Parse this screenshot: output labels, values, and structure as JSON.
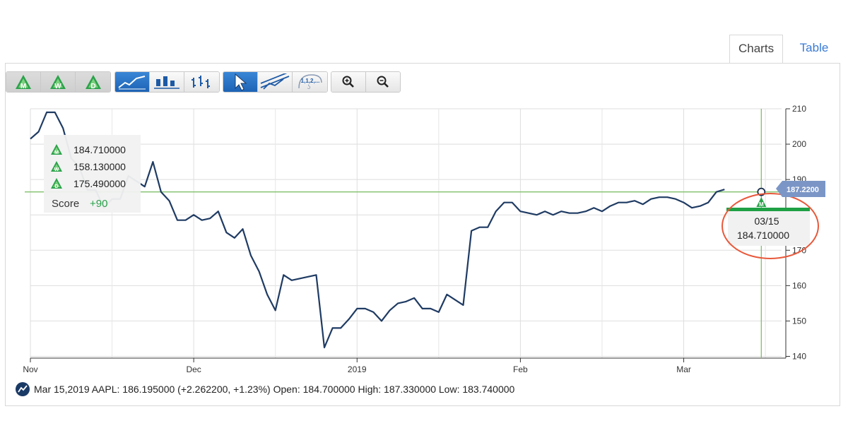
{
  "tabs": [
    {
      "label": "Charts",
      "active": true
    },
    {
      "label": "Table",
      "active": false
    }
  ],
  "toolbar": {
    "groups": [
      [
        {
          "name": "mag-m-icon",
          "letter": "M",
          "state": "on"
        },
        {
          "name": "mag-w-icon",
          "letter": "W",
          "state": "on"
        },
        {
          "name": "mag-d-icon",
          "letter": "D",
          "state": "on"
        }
      ],
      [
        {
          "name": "line-chart-icon",
          "state": "blue"
        },
        {
          "name": "candlestick-icon",
          "state": "off"
        },
        {
          "name": "ohlc-bar-icon",
          "state": "off"
        }
      ],
      [
        {
          "name": "pointer-icon",
          "state": "blue"
        },
        {
          "name": "trendline-icon",
          "state": "off"
        },
        {
          "name": "fibonacci-icon",
          "label": "1,1,2,...",
          "state": "off"
        }
      ],
      [
        {
          "name": "zoom-in-icon",
          "state": "off"
        },
        {
          "name": "zoom-out-icon",
          "state": "off"
        }
      ]
    ]
  },
  "chart_data": {
    "type": "line",
    "title": "",
    "xlabel": "",
    "ylabel": "",
    "series": [
      {
        "values": [
          201.5,
          203.5,
          209,
          209,
          204.5,
          196,
          193.5,
          187,
          187,
          182,
          184.5,
          184.5,
          191,
          189.5,
          188,
          195,
          186.5,
          184,
          178.5,
          178.5,
          180,
          178.5,
          179,
          181,
          175,
          173.5,
          176,
          168.5,
          164,
          157.5,
          153,
          163,
          161.5,
          162,
          162.5,
          163,
          142.5,
          148,
          148,
          150.5,
          153.5,
          153.5,
          152.5,
          150,
          153,
          155,
          155.5,
          156.5,
          153.5,
          153.5,
          152.5,
          157.5,
          156,
          154.5,
          175.5,
          176.5,
          176.5,
          181,
          183.5,
          183.5,
          181,
          180.5,
          180,
          181,
          180,
          181,
          180.5,
          180.5,
          181,
          182,
          181,
          182.5,
          183.5,
          183.5,
          184,
          183,
          184.5,
          185,
          185,
          184.5,
          183.5,
          182,
          182.5,
          183.5,
          186.5,
          187.2
        ]
      }
    ],
    "xlim": [
      0,
      92.5
    ],
    "ylim": [
      139.5,
      210
    ],
    "x_ticks": [
      {
        "label": "Nov",
        "x": 0
      },
      {
        "label": "Dec",
        "x": 20
      },
      {
        "label": "2019",
        "x": 40
      },
      {
        "label": "Feb",
        "x": 60
      },
      {
        "label": "Mar",
        "x": 80
      }
    ],
    "y_ticks": [
      140,
      150,
      160,
      170,
      180,
      190,
      200,
      210
    ],
    "grid": true,
    "colors": {
      "line": "#1f3b63",
      "crosshair": "#7fc06a",
      "marker_bar": "#1fa045",
      "highlight_circle": "#e8583a",
      "price_tag": "#7b96c6",
      "mag_green": "#2aa24a"
    },
    "crosshair": {
      "x": 89.5,
      "y": 186.5
    },
    "price_tag": "187.2200",
    "tooltip_left": {
      "rows": [
        {
          "letter": "M",
          "value": "184.710000"
        },
        {
          "letter": "W",
          "value": "158.130000"
        },
        {
          "letter": "D",
          "value": "175.490000"
        }
      ],
      "score_label": "Score",
      "score_value": "+90"
    },
    "tooltip_right": {
      "date": "03/15",
      "value": "184.710000"
    },
    "marker_letter": "M",
    "legend": "Mar 15,2019 AAPL: 186.195000 (+2.262200, +1.23%) Open: 184.700000 High: 187.330000 Low: 183.740000"
  }
}
